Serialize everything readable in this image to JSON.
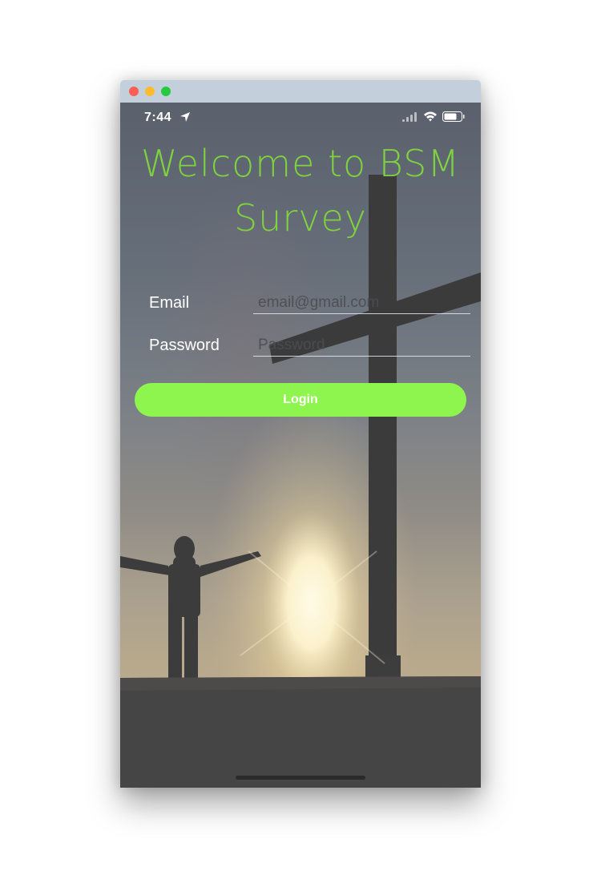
{
  "window": {
    "traffic_lights": [
      "close",
      "minimize",
      "maximize"
    ]
  },
  "status_bar": {
    "time": "7:44",
    "icons": [
      "location-arrow-icon",
      "cellular-signal-icon",
      "wifi-icon",
      "battery-icon"
    ]
  },
  "header": {
    "title_line1": "Welcome to BSM",
    "title_line2": "Survey",
    "title_color": "#7fd23f"
  },
  "form": {
    "email_label": "Email",
    "email_placeholder": "email@gmail.com",
    "password_label": "Password",
    "password_placeholder": "Password",
    "login_label": "Login",
    "button_color": "#8ef54e"
  }
}
